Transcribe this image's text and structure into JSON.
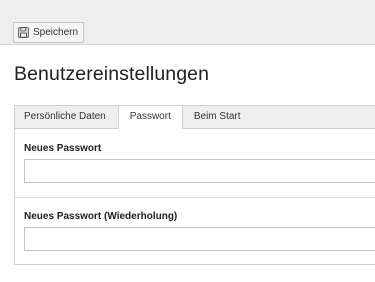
{
  "toolbar": {
    "save_label": "Speichern",
    "save_icon": "save-icon"
  },
  "page": {
    "title": "Benutzereinstellungen"
  },
  "tabs": [
    {
      "label": "Persönliche Daten",
      "active": false
    },
    {
      "label": "Passwort",
      "active": true
    },
    {
      "label": "Beim Start",
      "active": false
    }
  ],
  "form": {
    "new_password": {
      "label": "Neues Passwort",
      "value": ""
    },
    "new_password_repeat": {
      "label": "Neues Passwort (Wiederholung)",
      "value": ""
    }
  }
}
